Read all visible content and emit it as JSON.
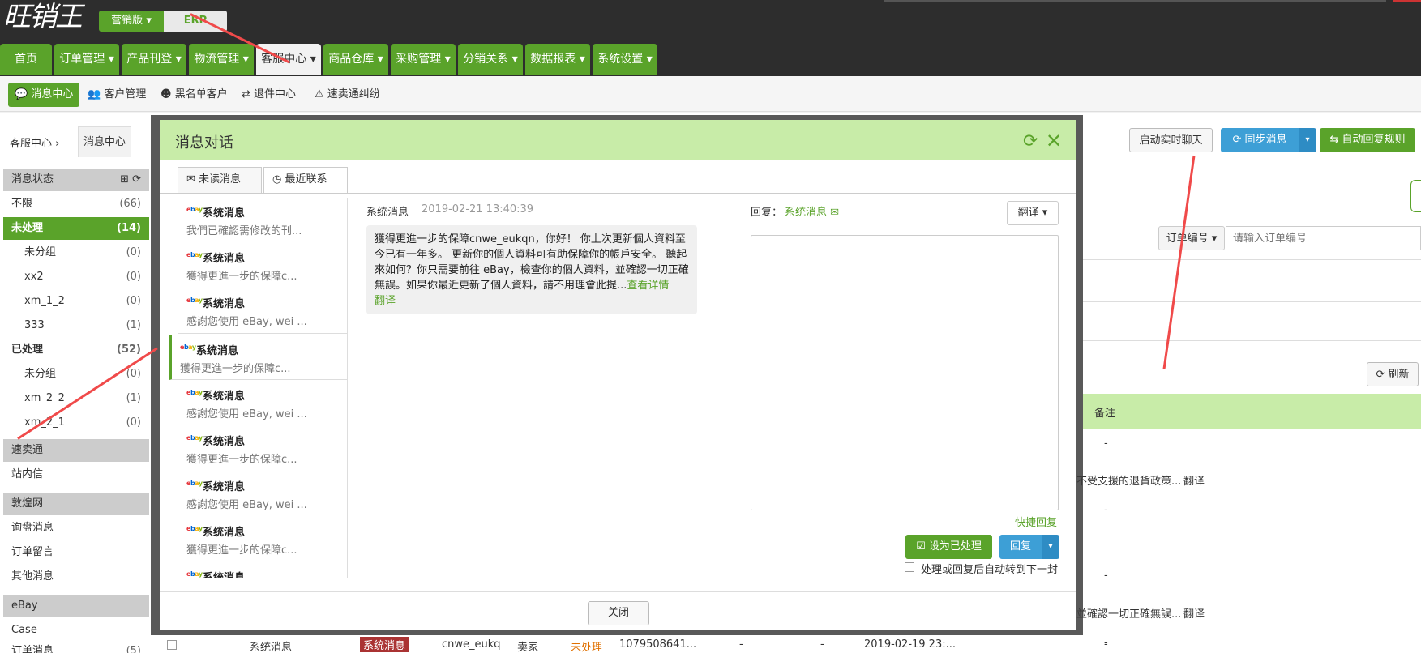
{
  "app": {
    "logo": "旺销王",
    "version_label": "营销版",
    "erp_label": "ERP"
  },
  "main_nav": [
    {
      "label": "首页"
    },
    {
      "label": "订单管理"
    },
    {
      "label": "产品刊登"
    },
    {
      "label": "物流管理"
    },
    {
      "label": "客服中心",
      "active": true
    },
    {
      "label": "商品仓库"
    },
    {
      "label": "采购管理"
    },
    {
      "label": "分销关系"
    },
    {
      "label": "数据报表"
    },
    {
      "label": "系统设置"
    }
  ],
  "sub_nav": [
    {
      "label": "消息中心",
      "icon": "chat-icon",
      "active": true
    },
    {
      "label": "客户管理",
      "icon": "users-icon"
    },
    {
      "label": "黑名单客户",
      "icon": "blacklist-icon"
    },
    {
      "label": "退件中心",
      "icon": "return-icon"
    },
    {
      "label": "速卖通纠纷",
      "icon": "warning-icon"
    }
  ],
  "breadcrumb": {
    "root": "客服中心",
    "current": "消息中心"
  },
  "sidebar": {
    "status_header": "消息状态",
    "items": [
      {
        "label": "不限",
        "count": "(66)"
      },
      {
        "label": "未处理",
        "count": "(14)",
        "active": true
      },
      {
        "label": "未分组",
        "count": "(0)",
        "sub": true
      },
      {
        "label": "xx2",
        "count": "(0)",
        "sub": true
      },
      {
        "label": "xm_1_2",
        "count": "(0)",
        "sub": true
      },
      {
        "label": "333",
        "count": "(1)",
        "sub": true
      },
      {
        "label": "已处理",
        "count": "(52)",
        "bold": true
      },
      {
        "label": "未分组",
        "count": "(0)",
        "sub": true
      },
      {
        "label": "xm_2_2",
        "count": "(1)",
        "sub": true
      },
      {
        "label": "xm_2_1",
        "count": "(0)",
        "sub": true
      }
    ],
    "sections": [
      {
        "header": "速卖通",
        "items": [
          "站内信"
        ]
      },
      {
        "header": "敦煌网",
        "items": [
          "询盘消息",
          "订单留言",
          "其他消息"
        ]
      },
      {
        "header": "eBay",
        "items": [
          "Case",
          "订单消息"
        ]
      }
    ],
    "last_count": "(5)"
  },
  "right_toolbar": {
    "live_chat": "启动实时聊天",
    "sync": "同步消息",
    "auto_reply": "自动回复规则",
    "order_no_dropdown": "订单编号",
    "order_no_placeholder": "请输入订单编号",
    "refresh": "刷新",
    "col_remark": "备注",
    "row_texts": [
      "-",
      "不受支援的退貨政策...",
      "翻译",
      "-",
      "-",
      "並確認一切正確無誤...",
      "翻译",
      "-"
    ],
    "bottom_row": [
      "系统消息",
      "系统消息",
      "cnwe_eukq",
      "卖家",
      "未处理",
      "1079508641...",
      "-",
      "-",
      "2019-02-19 23:...",
      "-"
    ]
  },
  "modal": {
    "title": "消息对话",
    "tabs": [
      {
        "label": "未读消息"
      },
      {
        "label": "最近联系",
        "active": true
      }
    ],
    "list": [
      {
        "title": "系统消息",
        "snippet": "我們已確認需修改的刊..."
      },
      {
        "title": "系统消息",
        "snippet": "獲得更進一步的保障c..."
      },
      {
        "title": "系统消息",
        "snippet": "感謝您使用 eBay, wei ..."
      },
      {
        "title": "系统消息",
        "snippet": "獲得更進一步的保障c...",
        "selected": true
      },
      {
        "title": "系统消息",
        "snippet": "感謝您使用 eBay, wei ..."
      },
      {
        "title": "系统消息",
        "snippet": "獲得更進一步的保障c..."
      },
      {
        "title": "系统消息",
        "snippet": "感謝您使用 eBay, wei ..."
      },
      {
        "title": "系统消息",
        "snippet": "獲得更進一步的保障c..."
      },
      {
        "title": "系统消息",
        "snippet": ""
      }
    ],
    "message": {
      "sender": "系统消息",
      "time": "2019-02-21 13:40:39",
      "body": "獲得更進一步的保障cnwe_eukqn，你好！ 你上次更新個人資料至今已有一年多。 更新你的個人資料可有助保障你的帳戶安全。 聽起來如何？你只需要前往 eBay，檢查你的個人資料，並確認一切正確無誤。如果你最近更新了個人資料，請不用理會此提...",
      "view_more": "查看详情",
      "translate": "翻译"
    },
    "reply": {
      "label": "回复：",
      "recipient": "系统消息",
      "translate_btn": "翻译",
      "quick_reply": "快捷回复",
      "mark_done": "设为已处理",
      "reply_btn": "回复",
      "auto_next": "处理或回复后自动转到下一封"
    },
    "close_btn": "关闭"
  },
  "colors": {
    "green": "#5aa32a",
    "blue": "#3d9fd6",
    "annotation_red": "#f04a4a"
  }
}
